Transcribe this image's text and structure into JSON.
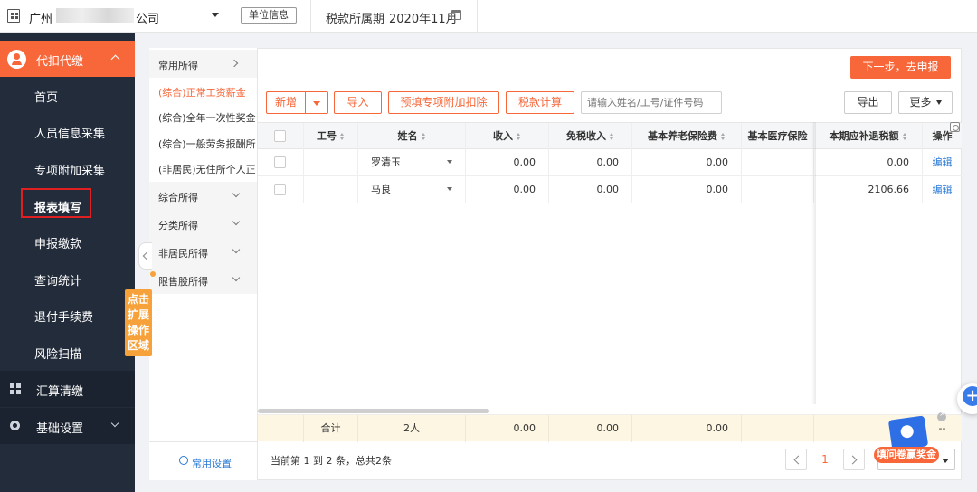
{
  "topbar": {
    "org_prefix": "广州",
    "org_suffix": "公司",
    "unit_info_label": "单位信息",
    "period_label": "税款所属期",
    "period_value": "2020年11月"
  },
  "sidebar": {
    "section_label": "代扣代缴",
    "items": [
      {
        "label": "首页"
      },
      {
        "label": "人员信息采集"
      },
      {
        "label": "专项附加采集"
      },
      {
        "label": "报表填写"
      },
      {
        "label": "申报缴款"
      },
      {
        "label": "查询统计"
      },
      {
        "label": "退付手续费"
      },
      {
        "label": "风险扫描"
      }
    ],
    "groups": [
      {
        "label": "汇算清缴"
      },
      {
        "label": "基础设置"
      }
    ]
  },
  "leftnav": {
    "groups": [
      {
        "label": "常用所得"
      },
      {
        "label": "综合所得"
      },
      {
        "label": "分类所得"
      },
      {
        "label": "非居民所得"
      },
      {
        "label": "限售股所得"
      }
    ],
    "items": [
      {
        "label": "(综合)正常工资薪金"
      },
      {
        "label": "(综合)全年一次性奖金"
      },
      {
        "label": "(综合)一般劳务报酬所..."
      },
      {
        "label": "(非居民)无住所个人正..."
      }
    ],
    "footer_label": "常用设置"
  },
  "expand_tip": "点击扩展操作区域",
  "toolbar": {
    "next_label": "下一步，去申报",
    "add_label": "新增",
    "import_label": "导入",
    "prefill_label": "预填专项附加扣除",
    "calc_label": "税款计算",
    "search_placeholder": "请输入姓名/工号/证件号码",
    "export_label": "导出",
    "more_label": "更多"
  },
  "table": {
    "headers": [
      "工号",
      "姓名",
      "收入",
      "免税收入",
      "基本养老保险费",
      "基本医疗保险",
      "本期应补退税额",
      "操作"
    ],
    "rows": [
      {
        "id": "",
        "name": "罗清玉",
        "income": "0.00",
        "exempt": "0.00",
        "pension": "0.00",
        "medical": "",
        "tax": "0.00",
        "action": "编辑"
      },
      {
        "id": "",
        "name": "马良",
        "income": "0.00",
        "exempt": "0.00",
        "pension": "0.00",
        "medical": "",
        "tax": "2106.66",
        "action": "编辑"
      }
    ],
    "footer": {
      "label": "合计",
      "count": "2人",
      "income": "0.00",
      "exempt": "0.00",
      "pension": "0.00",
      "dash": "--"
    }
  },
  "pager": {
    "summary": "当前第 1 到 2 条，总共2条",
    "current_page": "1"
  },
  "promo": {
    "label": "填问卷赢奖金"
  }
}
